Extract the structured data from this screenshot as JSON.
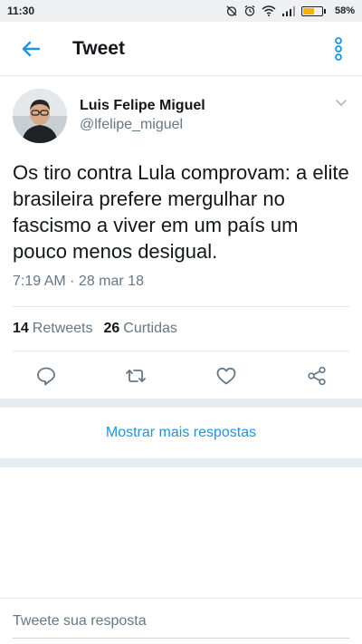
{
  "status_bar": {
    "time": "11:30",
    "battery_percent_label": "58%",
    "battery_level": 0.58,
    "icons": [
      "alarm-off-icon",
      "alarm-icon",
      "wifi-icon",
      "signal-icon",
      "battery-icon"
    ]
  },
  "app_bar": {
    "title": "Tweet",
    "back_icon": "arrow-left-icon",
    "overflow_icon": "vertical-dots-icon"
  },
  "tweet": {
    "author_name": "Luis Felipe Miguel",
    "author_handle": "@lfelipe_miguel",
    "text": "Os tiro contra Lula comprovam: a elite brasileira prefere mergulhar no fascismo a viver em um país um pouco menos desigual.",
    "timestamp": "7:19 AM · 28 mar 18",
    "retweets_count": "14",
    "retweets_label": "Retweets",
    "likes_count": "26",
    "likes_label": "Curtidas"
  },
  "actions": [
    "reply-icon",
    "retweet-icon",
    "like-icon",
    "share-icon"
  ],
  "more_replies_label": "Mostrar mais respostas",
  "reply": {
    "placeholder": "Tweete sua resposta"
  },
  "colors": {
    "accent": "#1b95e0",
    "text": "#14171a",
    "secondary_text": "#657786",
    "divider_band": "#e6ecf0"
  }
}
